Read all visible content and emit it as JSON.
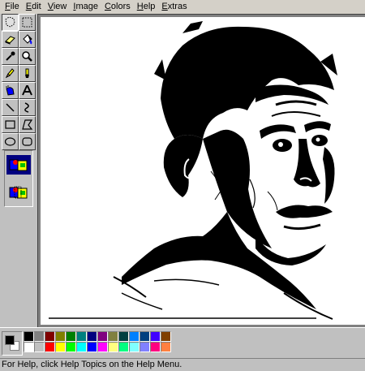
{
  "menu": {
    "items": [
      "File",
      "Edit",
      "View",
      "Image",
      "Colors",
      "Help",
      "Extras"
    ]
  },
  "tools": [
    {
      "name": "free-form-select-tool-icon",
      "active": true
    },
    {
      "name": "select-tool-icon"
    },
    {
      "name": "eraser-tool-icon"
    },
    {
      "name": "fill-tool-icon"
    },
    {
      "name": "pick-color-tool-icon"
    },
    {
      "name": "magnifier-tool-icon"
    },
    {
      "name": "pencil-tool-icon"
    },
    {
      "name": "brush-tool-icon"
    },
    {
      "name": "airbrush-tool-icon"
    },
    {
      "name": "text-tool-icon"
    },
    {
      "name": "line-tool-icon"
    },
    {
      "name": "curve-tool-icon"
    },
    {
      "name": "rectangle-tool-icon"
    },
    {
      "name": "polygon-tool-icon"
    },
    {
      "name": "ellipse-tool-icon"
    },
    {
      "name": "rounded-rectangle-tool-icon"
    }
  ],
  "options": [
    {
      "name": "opaque-selection-icon",
      "selected": true
    },
    {
      "name": "transparent-selection-icon",
      "selected": false
    }
  ],
  "colors": {
    "foreground": "#000000",
    "background": "#ffffff",
    "palette": [
      "#000000",
      "#808080",
      "#800000",
      "#808000",
      "#008000",
      "#008080",
      "#000080",
      "#800080",
      "#808040",
      "#004040",
      "#0080ff",
      "#004080",
      "#4000ff",
      "#804000",
      "#ffffff",
      "#c0c0c0",
      "#ff0000",
      "#ffff00",
      "#00ff00",
      "#00ffff",
      "#0000ff",
      "#ff00ff",
      "#ffff80",
      "#00ff80",
      "#80ffff",
      "#8080ff",
      "#ff0080",
      "#ff8040"
    ]
  },
  "status": {
    "text": "For Help, click Help Topics on the Help Menu."
  }
}
